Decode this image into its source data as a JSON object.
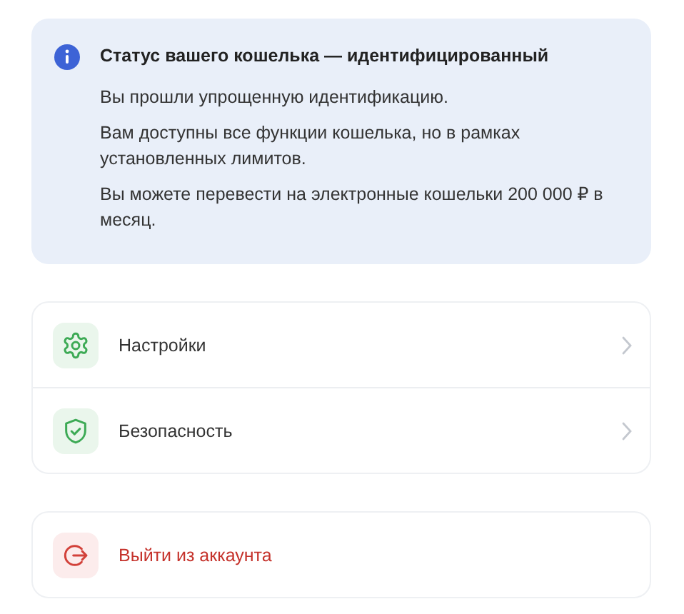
{
  "status_notice": {
    "title": "Статус вашего кошелька — идентифицированный",
    "paragraphs": [
      "Вы прошли упрощенную идентификацию.",
      "Вам доступны все функции кошелька, но в рамках установленных лимитов.",
      "Вы можете перевести на электронные кошельки 200 000 ₽ в месяц."
    ]
  },
  "menu": [
    {
      "kind": "settings",
      "label": "Настройки"
    },
    {
      "kind": "security",
      "label": "Безопасность"
    }
  ],
  "logout": {
    "label": "Выйти из аккаунта"
  }
}
